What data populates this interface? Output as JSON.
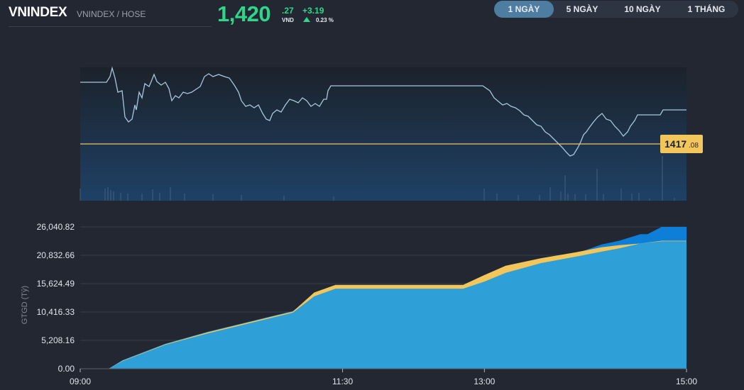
{
  "header": {
    "symbol": "VNINDEX",
    "exchange": "VNINDEX / HOSE",
    "price_int": "1,420",
    "price_dec": ".27",
    "currency": "VND",
    "change": "+3.19",
    "change_pct": "0.23 %"
  },
  "range_tabs": [
    {
      "label": "1 NGÀY",
      "active": true
    },
    {
      "label": "5 NGÀY",
      "active": false
    },
    {
      "label": "10 NGÀY",
      "active": false
    },
    {
      "label": "1 THÁNG",
      "active": false
    }
  ],
  "colors": {
    "up": "#2fd68a",
    "price_line": "#a9c7dc",
    "ref_line": "#f2c65b",
    "area_light": "#2f9fd8",
    "area_dark": "#0d7fd8",
    "area_orange": "#f2c65b",
    "background": "#222731"
  },
  "price_chart": {
    "reference_label_int": "1417",
    "reference_label_dec": ".08"
  },
  "chart_data": {
    "type": "area",
    "ylabel": "GTGD (Tỷ)",
    "y_ticks": [
      "26,040.82",
      "20,832.66",
      "15,624.49",
      "10,416.33",
      "5,208.16",
      "0.00"
    ],
    "ylim": [
      0,
      26040.82
    ],
    "x_ticks": [
      "09:00",
      "11:30",
      "13:00",
      "15:00"
    ],
    "series": [
      {
        "values": [
          [
            0,
            0
          ],
          [
            40,
            0
          ],
          [
            60,
            1600
          ],
          [
            120,
            4600
          ],
          [
            180,
            6800
          ],
          [
            240,
            8700
          ],
          [
            300,
            10600
          ],
          [
            330,
            13500
          ],
          [
            360,
            15000
          ],
          [
            400,
            15000
          ],
          [
            500,
            15000
          ],
          [
            540,
            15000
          ],
          [
            570,
            16600
          ],
          [
            600,
            18300
          ],
          [
            650,
            20000
          ],
          [
            700,
            21200
          ],
          [
            735,
            22800
          ],
          [
            760,
            23500
          ],
          [
            790,
            24700
          ],
          [
            800,
            24700
          ],
          [
            820,
            26040
          ],
          [
            855,
            26040
          ]
        ]
      },
      {
        "values": [
          [
            0,
            0
          ],
          [
            40,
            0
          ],
          [
            60,
            1400
          ],
          [
            120,
            4400
          ],
          [
            180,
            6500
          ],
          [
            240,
            8400
          ],
          [
            300,
            10300
          ],
          [
            330,
            13300
          ],
          [
            360,
            14700
          ],
          [
            400,
            14700
          ],
          [
            500,
            14700
          ],
          [
            540,
            14700
          ],
          [
            570,
            16000
          ],
          [
            600,
            17600
          ],
          [
            650,
            19400
          ],
          [
            700,
            20600
          ],
          [
            735,
            21500
          ],
          [
            760,
            22100
          ],
          [
            790,
            23000
          ],
          [
            820,
            23400
          ],
          [
            855,
            23400
          ]
        ]
      },
      {
        "values": [
          [
            0,
            0
          ],
          [
            40,
            0
          ],
          [
            60,
            1500
          ],
          [
            120,
            4500
          ],
          [
            180,
            6700
          ],
          [
            240,
            8600
          ],
          [
            300,
            10500
          ],
          [
            330,
            14000
          ],
          [
            360,
            15400
          ],
          [
            400,
            15400
          ],
          [
            500,
            15400
          ],
          [
            540,
            15400
          ],
          [
            570,
            17200
          ],
          [
            600,
            18900
          ],
          [
            650,
            20300
          ],
          [
            700,
            21400
          ],
          [
            735,
            22300
          ],
          [
            760,
            22700
          ],
          [
            790,
            23000
          ],
          [
            820,
            23500
          ],
          [
            855,
            23500
          ]
        ]
      }
    ]
  }
}
